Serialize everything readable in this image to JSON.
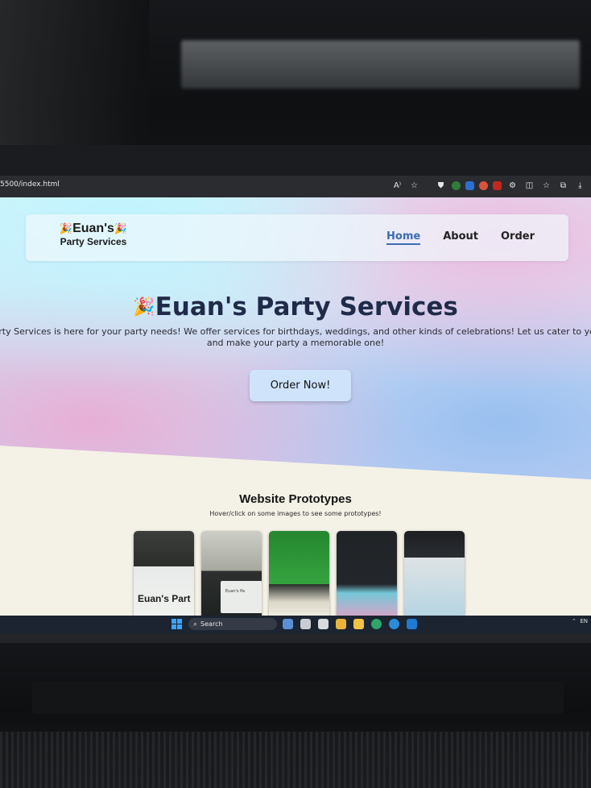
{
  "browser": {
    "url": "5500/index.html",
    "toolbar_icons": [
      "read-aloud-icon",
      "star-icon",
      "shield-icon",
      "extension-icon",
      "extension-icon",
      "extension-icon",
      "pdf-icon",
      "puzzle-icon",
      "split-view-icon",
      "favorites-icon",
      "collections-icon",
      "download-icon"
    ],
    "read_aloud_glyph": "A⁾"
  },
  "navbar": {
    "logo_line1": "Euan's",
    "logo_line2": "Party Services",
    "links": [
      {
        "label": "Home",
        "active": true
      },
      {
        "label": "About",
        "active": false
      },
      {
        "label": "Order",
        "active": false
      }
    ]
  },
  "hero": {
    "title": "Euan's Party Services",
    "text_line1": "'s Party Services is here for your party needs! We offer services for birthdays, weddings, and other kinds of celebrations! Let us cater to your n",
    "text_line2": "and make your party a memorable one!",
    "button": "Order Now!"
  },
  "prototypes": {
    "title": "Website Prototypes",
    "subtitle": "Hover/click on some images to see some prototypes!",
    "cards": [
      {
        "caption": "Euan's Part"
      },
      {
        "caption": "Euan's Pa"
      },
      {
        "caption": ""
      },
      {
        "caption": ""
      },
      {
        "caption": ""
      }
    ]
  },
  "taskbar": {
    "search_label": "Search",
    "tray_text": "EN"
  }
}
